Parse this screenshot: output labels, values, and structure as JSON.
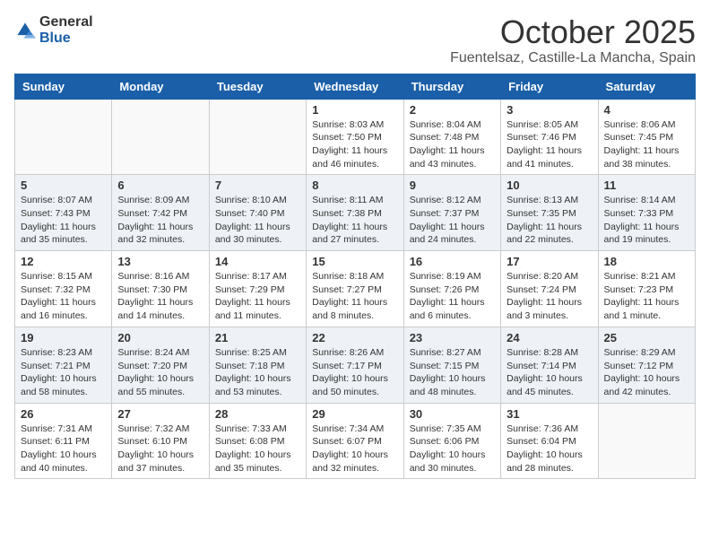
{
  "header": {
    "logo_general": "General",
    "logo_blue": "Blue",
    "month_title": "October 2025",
    "location": "Fuentelsaz, Castille-La Mancha, Spain"
  },
  "weekdays": [
    "Sunday",
    "Monday",
    "Tuesday",
    "Wednesday",
    "Thursday",
    "Friday",
    "Saturday"
  ],
  "weeks": [
    {
      "shaded": false,
      "days": [
        {
          "num": "",
          "info": ""
        },
        {
          "num": "",
          "info": ""
        },
        {
          "num": "",
          "info": ""
        },
        {
          "num": "1",
          "info": "Sunrise: 8:03 AM\nSunset: 7:50 PM\nDaylight: 11 hours\nand 46 minutes."
        },
        {
          "num": "2",
          "info": "Sunrise: 8:04 AM\nSunset: 7:48 PM\nDaylight: 11 hours\nand 43 minutes."
        },
        {
          "num": "3",
          "info": "Sunrise: 8:05 AM\nSunset: 7:46 PM\nDaylight: 11 hours\nand 41 minutes."
        },
        {
          "num": "4",
          "info": "Sunrise: 8:06 AM\nSunset: 7:45 PM\nDaylight: 11 hours\nand 38 minutes."
        }
      ]
    },
    {
      "shaded": true,
      "days": [
        {
          "num": "5",
          "info": "Sunrise: 8:07 AM\nSunset: 7:43 PM\nDaylight: 11 hours\nand 35 minutes."
        },
        {
          "num": "6",
          "info": "Sunrise: 8:09 AM\nSunset: 7:42 PM\nDaylight: 11 hours\nand 32 minutes."
        },
        {
          "num": "7",
          "info": "Sunrise: 8:10 AM\nSunset: 7:40 PM\nDaylight: 11 hours\nand 30 minutes."
        },
        {
          "num": "8",
          "info": "Sunrise: 8:11 AM\nSunset: 7:38 PM\nDaylight: 11 hours\nand 27 minutes."
        },
        {
          "num": "9",
          "info": "Sunrise: 8:12 AM\nSunset: 7:37 PM\nDaylight: 11 hours\nand 24 minutes."
        },
        {
          "num": "10",
          "info": "Sunrise: 8:13 AM\nSunset: 7:35 PM\nDaylight: 11 hours\nand 22 minutes."
        },
        {
          "num": "11",
          "info": "Sunrise: 8:14 AM\nSunset: 7:33 PM\nDaylight: 11 hours\nand 19 minutes."
        }
      ]
    },
    {
      "shaded": false,
      "days": [
        {
          "num": "12",
          "info": "Sunrise: 8:15 AM\nSunset: 7:32 PM\nDaylight: 11 hours\nand 16 minutes."
        },
        {
          "num": "13",
          "info": "Sunrise: 8:16 AM\nSunset: 7:30 PM\nDaylight: 11 hours\nand 14 minutes."
        },
        {
          "num": "14",
          "info": "Sunrise: 8:17 AM\nSunset: 7:29 PM\nDaylight: 11 hours\nand 11 minutes."
        },
        {
          "num": "15",
          "info": "Sunrise: 8:18 AM\nSunset: 7:27 PM\nDaylight: 11 hours\nand 8 minutes."
        },
        {
          "num": "16",
          "info": "Sunrise: 8:19 AM\nSunset: 7:26 PM\nDaylight: 11 hours\nand 6 minutes."
        },
        {
          "num": "17",
          "info": "Sunrise: 8:20 AM\nSunset: 7:24 PM\nDaylight: 11 hours\nand 3 minutes."
        },
        {
          "num": "18",
          "info": "Sunrise: 8:21 AM\nSunset: 7:23 PM\nDaylight: 11 hours\nand 1 minute."
        }
      ]
    },
    {
      "shaded": true,
      "days": [
        {
          "num": "19",
          "info": "Sunrise: 8:23 AM\nSunset: 7:21 PM\nDaylight: 10 hours\nand 58 minutes."
        },
        {
          "num": "20",
          "info": "Sunrise: 8:24 AM\nSunset: 7:20 PM\nDaylight: 10 hours\nand 55 minutes."
        },
        {
          "num": "21",
          "info": "Sunrise: 8:25 AM\nSunset: 7:18 PM\nDaylight: 10 hours\nand 53 minutes."
        },
        {
          "num": "22",
          "info": "Sunrise: 8:26 AM\nSunset: 7:17 PM\nDaylight: 10 hours\nand 50 minutes."
        },
        {
          "num": "23",
          "info": "Sunrise: 8:27 AM\nSunset: 7:15 PM\nDaylight: 10 hours\nand 48 minutes."
        },
        {
          "num": "24",
          "info": "Sunrise: 8:28 AM\nSunset: 7:14 PM\nDaylight: 10 hours\nand 45 minutes."
        },
        {
          "num": "25",
          "info": "Sunrise: 8:29 AM\nSunset: 7:12 PM\nDaylight: 10 hours\nand 42 minutes."
        }
      ]
    },
    {
      "shaded": false,
      "days": [
        {
          "num": "26",
          "info": "Sunrise: 7:31 AM\nSunset: 6:11 PM\nDaylight: 10 hours\nand 40 minutes."
        },
        {
          "num": "27",
          "info": "Sunrise: 7:32 AM\nSunset: 6:10 PM\nDaylight: 10 hours\nand 37 minutes."
        },
        {
          "num": "28",
          "info": "Sunrise: 7:33 AM\nSunset: 6:08 PM\nDaylight: 10 hours\nand 35 minutes."
        },
        {
          "num": "29",
          "info": "Sunrise: 7:34 AM\nSunset: 6:07 PM\nDaylight: 10 hours\nand 32 minutes."
        },
        {
          "num": "30",
          "info": "Sunrise: 7:35 AM\nSunset: 6:06 PM\nDaylight: 10 hours\nand 30 minutes."
        },
        {
          "num": "31",
          "info": "Sunrise: 7:36 AM\nSunset: 6:04 PM\nDaylight: 10 hours\nand 28 minutes."
        },
        {
          "num": "",
          "info": ""
        }
      ]
    }
  ]
}
